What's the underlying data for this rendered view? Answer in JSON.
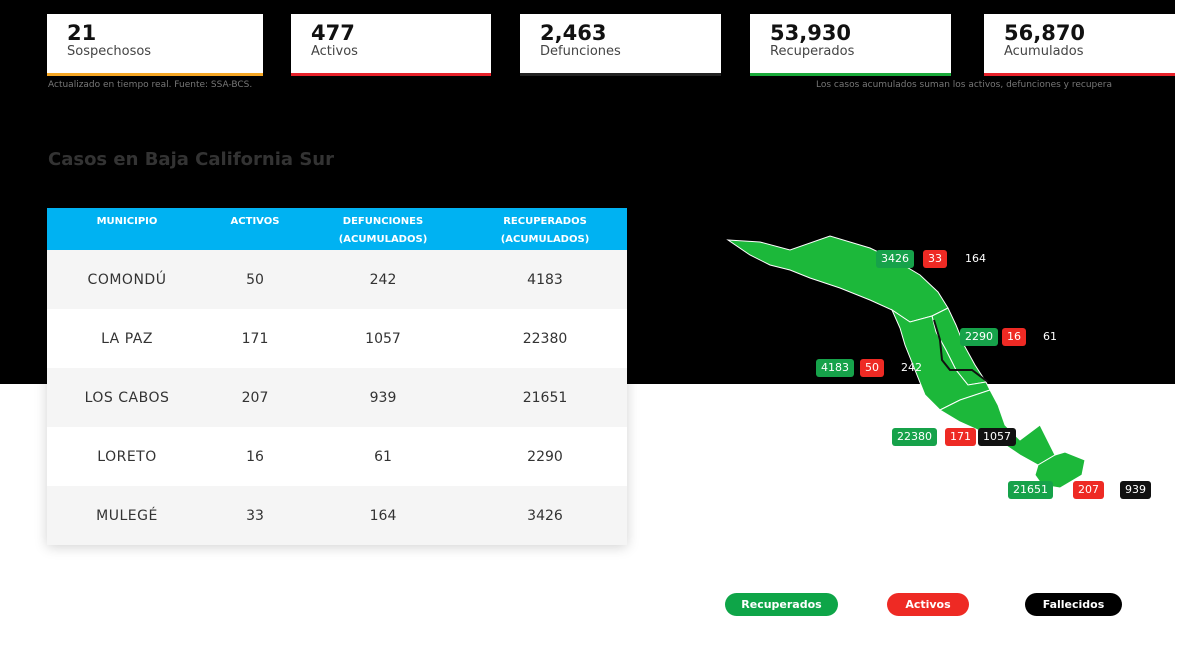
{
  "stats": [
    {
      "value": "21",
      "label": "Sospechosos"
    },
    {
      "value": "477",
      "label": "Activos"
    },
    {
      "value": "2,463",
      "label": "Defunciones"
    },
    {
      "value": "53,930",
      "label": "Recuperados"
    },
    {
      "value": "56,870",
      "label": "Acumulados"
    }
  ],
  "notes": {
    "left": "Actualizado en tiempo real. Fuente: SSA-BCS.",
    "right": "Los casos acumulados suman los activos, defunciones y recupera"
  },
  "section_title": "Casos en Baja California Sur",
  "table": {
    "headers": [
      "MUNICIPIO",
      "ACTIVOS",
      "DEFUNCIONES (ACUMULADOS)",
      "RECUPERADOS (ACUMULADOS)"
    ],
    "rows": [
      {
        "municipio": "COMONDÚ",
        "activos": "50",
        "defunciones": "242",
        "recuperados": "4183"
      },
      {
        "municipio": "LA PAZ",
        "activos": "171",
        "defunciones": "1057",
        "recuperados": "22380"
      },
      {
        "municipio": "LOS CABOS",
        "activos": "207",
        "defunciones": "939",
        "recuperados": "21651"
      },
      {
        "municipio": "LORETO",
        "activos": "16",
        "defunciones": "61",
        "recuperados": "2290"
      },
      {
        "municipio": "MULEGÉ",
        "activos": "33",
        "defunciones": "164",
        "recuperados": "3426"
      }
    ]
  },
  "map_labels": {
    "mulege": {
      "recuperados": "3426",
      "activos": "33",
      "fallecidos": "164"
    },
    "loreto": {
      "recuperados": "2290",
      "activos": "16",
      "fallecidos": "61"
    },
    "comondu": {
      "recuperados": "4183",
      "activos": "50",
      "fallecidos": "242"
    },
    "lapaz": {
      "recuperados": "22380",
      "activos": "171",
      "fallecidos": "1057"
    },
    "loscabos": {
      "recuperados": "21651",
      "activos": "207",
      "fallecidos": "939"
    }
  },
  "legend": {
    "recuperados": "Recuperados",
    "activos": "Activos",
    "fallecidos": "Fallecidos"
  },
  "colors": {
    "map_green": "#1cb83a",
    "header_blue": "#00b2f2",
    "recuperados": "#0ea548",
    "activos": "#ee2a24",
    "fallecidos": "#000000"
  }
}
